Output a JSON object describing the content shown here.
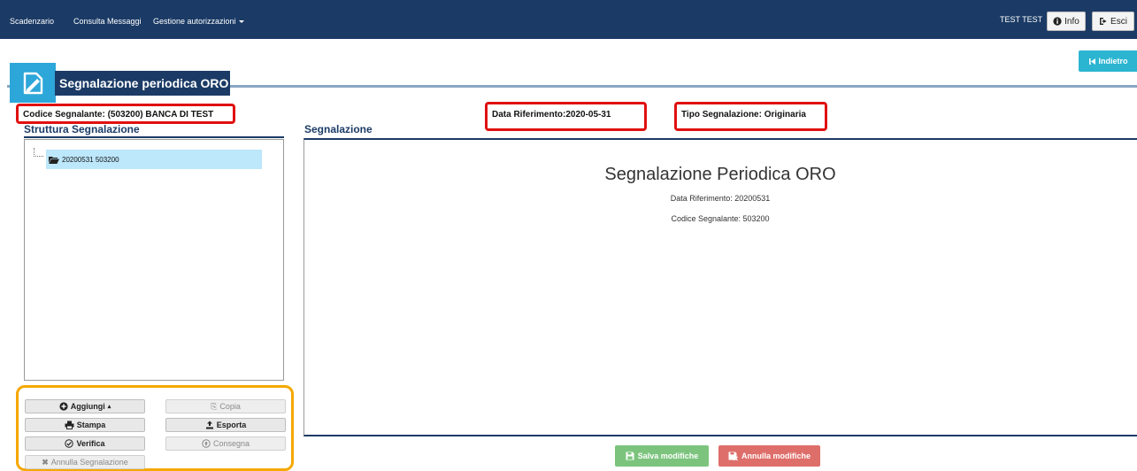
{
  "navbar": {
    "items": [
      {
        "label": "Scadenzario"
      },
      {
        "label": "Consulta Messaggi"
      },
      {
        "label": "Gestione autorizzazioni"
      }
    ],
    "user": "TEST TEST",
    "info_label": "Info",
    "exit_label": "Esci"
  },
  "back_label": "Indietro",
  "page_title": "Segnalazione periodica ORO",
  "info": {
    "codice": "Codice Segnalante: (503200) BANCA DI TEST",
    "data_riferimento": "Data Riferimento:2020-05-31",
    "tipo": "Tipo Segnalazione: Originaria"
  },
  "tree": {
    "heading": "Struttura Segnalazione",
    "items": [
      {
        "label": "20200531 503200"
      }
    ]
  },
  "actions": {
    "aggiungi": "Aggiungi",
    "copia": "Copia",
    "stampa": "Stampa",
    "esporta": "Esporta",
    "verifica": "Verifica",
    "consegna": "Consegna",
    "annulla_segnalazione": "Annulla Segnalazione"
  },
  "main": {
    "heading": "Segnalazione",
    "title": "Segnalazione Periodica ORO",
    "data_riferimento": "Data Riferimento: 20200531",
    "codice_segnalante": "Codice Segnalante: 503200"
  },
  "footer": {
    "save_label": "Salva modifiche",
    "cancel_label": "Annulla modifiche"
  },
  "colors": {
    "navbar": "#1b3b66",
    "accent": "#2da6d9",
    "highlight_red": "#e01010",
    "highlight_orange": "#f5a800",
    "save_green": "#7cc47e",
    "cancel_red": "#de6e6a"
  }
}
